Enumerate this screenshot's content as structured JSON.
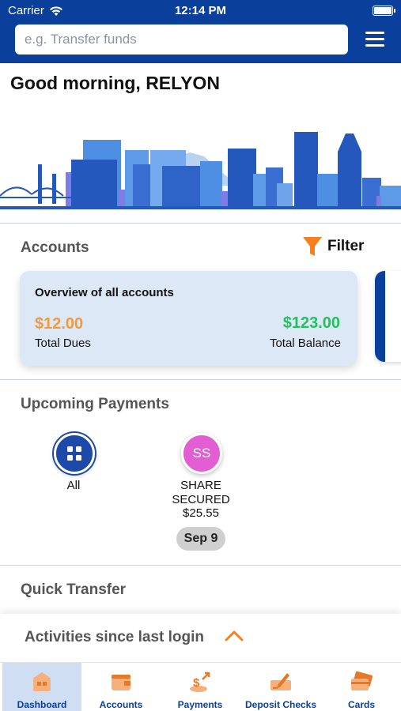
{
  "status_bar": {
    "carrier": "Carrier",
    "time": "12:14 PM"
  },
  "header": {
    "search_placeholder": "e.g. Transfer funds",
    "menu_icon": "hamburger-menu-icon"
  },
  "greeting": "Good morning, RELYON",
  "accounts": {
    "title": "Accounts",
    "filter_label": "Filter",
    "filter_icon": "funnel-icon",
    "card": {
      "title": "Overview of all accounts",
      "dues_value": "$12.00",
      "dues_label": "Total Dues",
      "balance_value": "$123.00",
      "balance_label": "Total Balance"
    }
  },
  "upcoming_payments": {
    "title": "Upcoming Payments",
    "items": [
      {
        "label": "All",
        "icon": "grid-icon"
      },
      {
        "initials": "SS",
        "name": "SHARE SECURED",
        "amount": "$25.55",
        "date": "Sep 9"
      }
    ]
  },
  "quick_transfer": {
    "title": "Quick Transfer"
  },
  "activities": {
    "label": "Activities since last login",
    "icon": "chevron-up-icon"
  },
  "tabs": [
    {
      "label": "Dashboard",
      "icon": "dashboard-icon",
      "active": true
    },
    {
      "label": "Accounts",
      "icon": "wallet-icon",
      "active": false
    },
    {
      "label": "Payments",
      "icon": "payments-icon",
      "active": false
    },
    {
      "label": "Deposit Checks",
      "icon": "deposit-check-icon",
      "active": false
    },
    {
      "label": "Cards",
      "icon": "cards-icon",
      "active": false
    }
  ],
  "colors": {
    "brand_blue": "#0b3f9c",
    "dues_orange": "#f29a3a",
    "balance_green": "#22c25b",
    "accent_orange": "#f5801f",
    "avatar_pink": "#e25ed2"
  }
}
